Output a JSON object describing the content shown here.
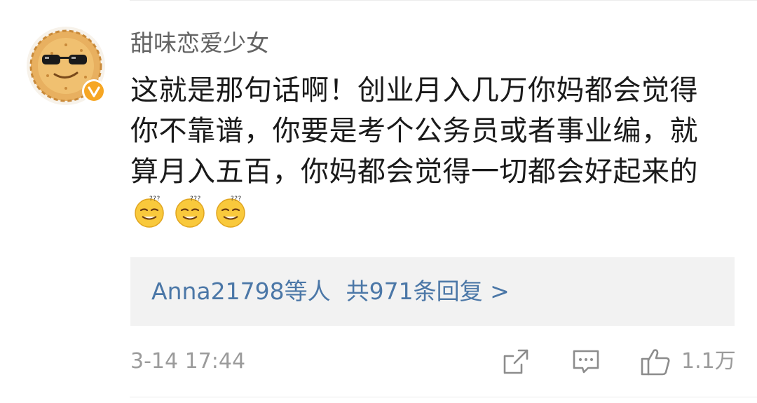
{
  "comment": {
    "username": "甜味恋爱少女",
    "text": "这就是那句话啊！创业月入几万你妈都会觉得你不靠谱，你要是考个公务员或者事业编，就算月入五百，你妈都会觉得一切都会好起来的",
    "emojis": [
      "smirk-sleepy-emoji",
      "smirk-sleepy-emoji",
      "smirk-sleepy-emoji"
    ],
    "verified": true
  },
  "replies": {
    "users_label": "Anna21798等人",
    "count_label": "共971条回复 >"
  },
  "meta": {
    "timestamp": "3-14 17:44",
    "like_count": "1.1万"
  },
  "colors": {
    "link_blue": "#4b77a7",
    "muted_gray": "#9b9b9b",
    "badge_orange": "#f6a623",
    "reply_bg": "#f2f2f2"
  }
}
